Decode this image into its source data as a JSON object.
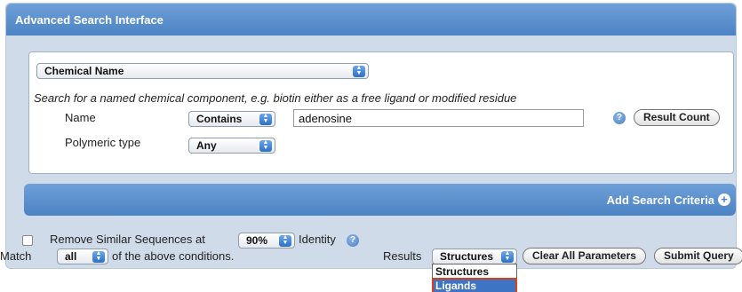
{
  "header": {
    "title": "Advanced Search Interface"
  },
  "criteria": {
    "type_select": "Chemical Name",
    "description": "Search for a named chemical component, e.g. biotin either as a free ligand or modified residue",
    "name_label": "Name",
    "name_operator": "Contains",
    "name_value": "adenosine",
    "polymeric_label": "Polymeric type",
    "polymeric_value": "Any",
    "help_icon": "question-icon",
    "result_count_label": "Result Count"
  },
  "add_criteria": {
    "label": "Add Search Criteria",
    "icon": "plus-circle-icon"
  },
  "options": {
    "remove_similar_prefix": "Remove Similar Sequences at",
    "identity_value": "90%",
    "identity_suffix": "Identity",
    "match_prefix": "Match",
    "match_value": "all",
    "match_suffix": "of the above conditions."
  },
  "footer": {
    "results_label": "Results",
    "results_value": "Structures",
    "clear_label": "Clear All Parameters",
    "submit_label": "Submit Query",
    "results_options": [
      "Structures",
      "Ligands"
    ]
  },
  "colors": {
    "accent": "#4c83c4",
    "highlight_border": "#d9401c"
  }
}
